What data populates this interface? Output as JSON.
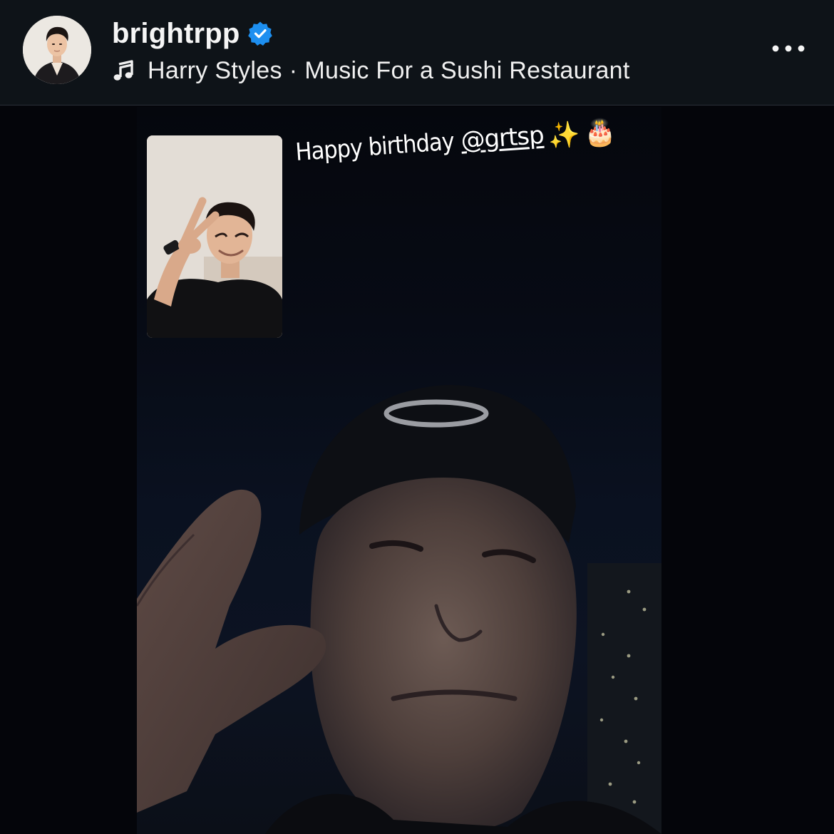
{
  "header": {
    "username": "brightrpp",
    "verified": true,
    "music": {
      "artist": "Harry Styles",
      "separator": "·",
      "song": "Music For a Sushi Restaurant"
    },
    "more_label": "•••"
  },
  "story": {
    "caption": "Happy birthday",
    "mention": "@grtsp",
    "emojis": [
      "✨",
      "🎂"
    ]
  },
  "colors": {
    "header_bg": "#0e1318",
    "verified_blue": "#1d8ff0",
    "text": "#f5f5f5",
    "story_bg": "#05070d"
  },
  "icons": [
    "verified-badge-icon",
    "music-note-icon",
    "more-options-icon"
  ]
}
